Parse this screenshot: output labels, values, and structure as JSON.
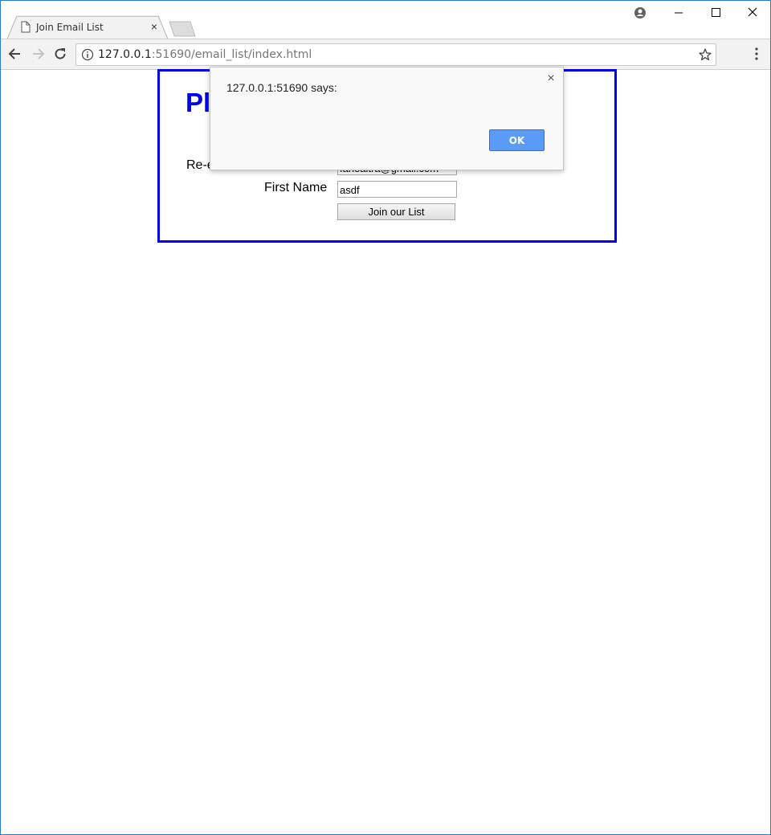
{
  "browser": {
    "tab_title": "Join Email List",
    "url_host": "127.0.0.1",
    "url_rest": ":51690/email_list/index.html"
  },
  "page": {
    "heading": "Pl",
    "reenter_label": "Re-e",
    "reenter_value": "fanoaitra@gmail.com",
    "first_name_label": "First Name",
    "first_name_value": "asdf",
    "submit_label": "Join our List"
  },
  "dialog": {
    "message": "127.0.0.1:51690 says:",
    "close_glyph": "×",
    "ok_label": "OK"
  },
  "icons": {
    "tab_close": "×"
  },
  "colors": {
    "accent": "#0000ee",
    "ok_button": "#5b9bf8"
  }
}
